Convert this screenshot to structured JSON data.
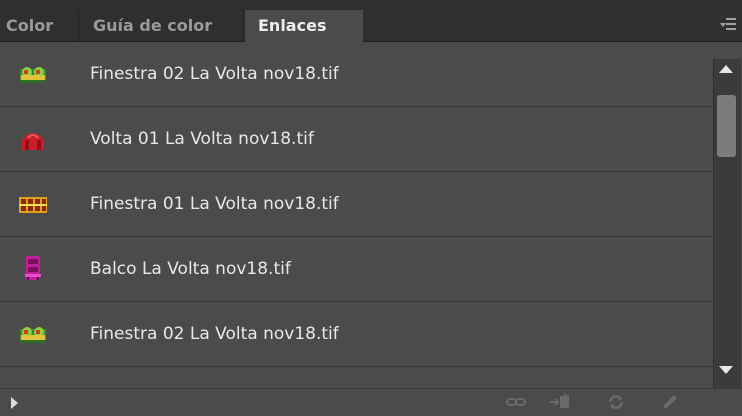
{
  "tabs": [
    {
      "label": "Color",
      "active": false
    },
    {
      "label": "Guía de color",
      "active": false
    },
    {
      "label": "Enlaces",
      "active": true
    }
  ],
  "panel_menu_icon": "panel-menu-icon",
  "links": [
    {
      "name": "Finestra 02 La Volta nov18.tif",
      "thumbnail": "thumbnail-green-window"
    },
    {
      "name": "Volta 01 La Volta nov18.tif",
      "thumbnail": "thumbnail-red-vault"
    },
    {
      "name": "Finestra 01 La Volta nov18.tif",
      "thumbnail": "thumbnail-orange-window"
    },
    {
      "name": "Balco La Volta nov18.tif",
      "thumbnail": "thumbnail-magenta-balcony"
    },
    {
      "name": "Finestra 02 La Volta nov18.tif",
      "thumbnail": "thumbnail-green-window"
    }
  ],
  "bottom_toolbar": {
    "expand_icon": "expand-triangle-icon",
    "buttons": [
      "relink-icon",
      "go-to-link-icon",
      "update-link-icon",
      "edit-original-icon"
    ]
  },
  "colors": {
    "panel_bg": "#4b4b4b",
    "tabbar_bg": "#2f2f2f",
    "text": "#e8e8e8"
  }
}
